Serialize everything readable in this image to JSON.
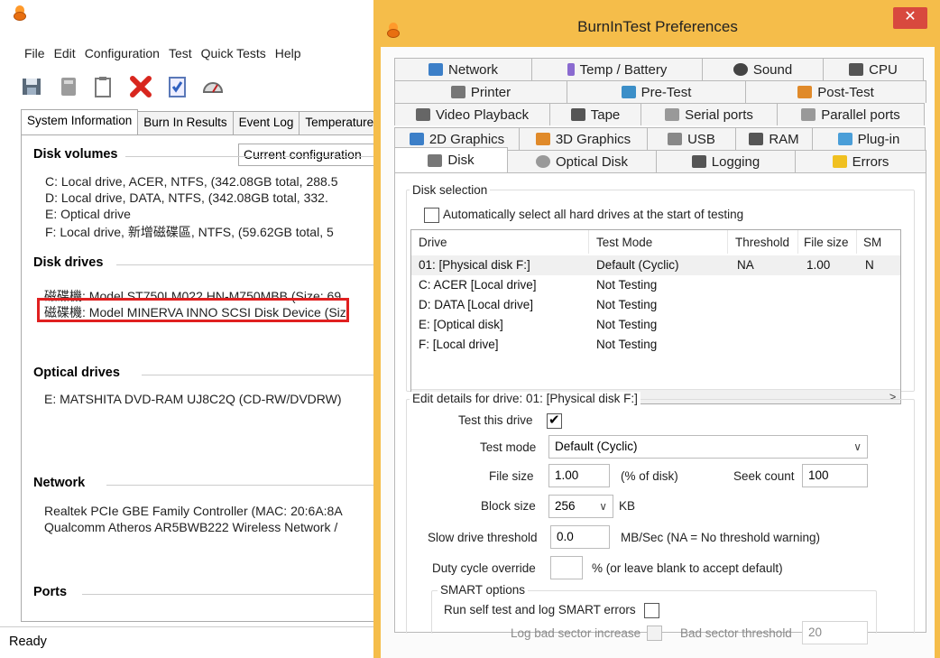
{
  "main_window": {
    "menu": [
      "File",
      "Edit",
      "Configuration",
      "Test",
      "Quick Tests",
      "Help"
    ],
    "config_box": "Current configuration",
    "tabs": [
      "System Information",
      "Burn In Results",
      "Event Log",
      "Temperature"
    ],
    "sections": {
      "disk_volumes": {
        "title": "Disk volumes",
        "lines": [
          "C:  Local drive, ACER, NTFS, (342.08GB total, 288.5",
          "D:  Local drive, DATA, NTFS, (342.08GB total, 332.",
          "E:  Optical drive",
          "F:  Local drive, 新增磁碟區, NTFS, (59.62GB total, 5"
        ]
      },
      "disk_drives": {
        "title": "Disk drives",
        "lines": [
          "磁碟機: Model ST750LM022 HN-M750MBB (Size: 69",
          "磁碟機: Model MINERVA INNO SCSI Disk Device (Siz"
        ]
      },
      "optical_drives": {
        "title": "Optical drives",
        "lines": [
          "E: MATSHITA DVD-RAM UJ8C2Q (CD-RW/DVDRW)"
        ]
      },
      "network": {
        "title": "Network",
        "lines": [
          "Realtek PCIe GBE Family Controller (MAC: 20:6A:8A",
          "Qualcomm Atheros AR5BWB222 Wireless Network /"
        ]
      },
      "ports": {
        "title": "Ports"
      }
    },
    "status": "Ready"
  },
  "dialog": {
    "title": "BurnInTest Preferences",
    "close": "✕",
    "tab_rows": [
      [
        {
          "label": "Network",
          "icon": "network-icon",
          "color": "#3c7fc8"
        },
        {
          "label": "Temp / Battery",
          "icon": "thermometer-icon",
          "color": "#8a6ad0"
        },
        {
          "label": "Sound",
          "icon": "speaker-icon",
          "color": "#444444"
        },
        {
          "label": "CPU",
          "icon": "cpu-icon",
          "color": "#555555"
        }
      ],
      [
        {
          "label": "Printer",
          "icon": "printer-icon",
          "color": "#777777"
        },
        {
          "label": "Pre-Test",
          "icon": "pretest-icon",
          "color": "#3c8fc8"
        },
        {
          "label": "Post-Test",
          "icon": "posttest-icon",
          "color": "#e08a2a"
        }
      ],
      [
        {
          "label": "Video Playback",
          "icon": "film-icon",
          "color": "#666666"
        },
        {
          "label": "Tape",
          "icon": "tape-icon",
          "color": "#555555"
        },
        {
          "label": "Serial ports",
          "icon": "serial-port-icon",
          "color": "#999999"
        },
        {
          "label": "Parallel ports",
          "icon": "parallel-port-icon",
          "color": "#999999"
        }
      ],
      [
        {
          "label": "2D Graphics",
          "icon": "monitor-icon",
          "color": "#3c7fc8"
        },
        {
          "label": "3D Graphics",
          "icon": "cubes-icon",
          "color": "#e08a2a"
        },
        {
          "label": "USB",
          "icon": "usb-icon",
          "color": "#888888"
        },
        {
          "label": "RAM",
          "icon": "ram-icon",
          "color": "#555555"
        },
        {
          "label": "Plug-in",
          "icon": "plugin-icon",
          "color": "#4a9ed8"
        }
      ],
      [
        {
          "label": "Disk",
          "icon": "disk-icon",
          "color": "#777777"
        },
        {
          "label": "Optical Disk",
          "icon": "optical-disc-icon",
          "color": "#999999"
        },
        {
          "label": "Logging",
          "icon": "log-icon",
          "color": "#555555"
        },
        {
          "label": "Errors",
          "icon": "warning-icon",
          "color": "#f0c020"
        }
      ]
    ],
    "disk_selection": {
      "group_label": "Disk selection",
      "auto_select_label": "Automatically select all hard drives at the start of testing",
      "columns": [
        "Drive",
        "Test Mode",
        "Threshold",
        "File size",
        "SM"
      ],
      "rows": [
        [
          "01:  [Physical disk F:]",
          "Default (Cyclic)",
          "NA",
          "1.00",
          "N"
        ],
        [
          "C:  ACER [Local drive]",
          "Not Testing",
          "",
          "",
          ""
        ],
        [
          "D:  DATA [Local drive]",
          "Not Testing",
          "",
          "",
          ""
        ],
        [
          "E:  [Optical disk]",
          "Not Testing",
          "",
          "",
          ""
        ],
        [
          "F:  [Local drive]",
          "Not Testing",
          "",
          "",
          ""
        ]
      ],
      "scroll_left": "<",
      "scroll_right": ">"
    },
    "edit_details": {
      "group_label": "Edit details for drive: 01:  [Physical disk F:]",
      "test_this_drive": "Test this drive",
      "test_mode_label": "Test mode",
      "test_mode_value": "Default (Cyclic)",
      "file_size_label": "File size",
      "file_size_value": "1.00",
      "file_size_unit": "(% of disk)",
      "seek_count_label": "Seek count",
      "seek_count_value": "100",
      "block_size_label": "Block size",
      "block_size_value": "256",
      "block_size_unit": "KB",
      "slow_threshold_label": "Slow drive threshold",
      "slow_threshold_value": "0.0",
      "slow_threshold_unit": "MB/Sec  (NA = No threshold warning)",
      "duty_cycle_label": "Duty cycle override",
      "duty_cycle_value": "",
      "duty_cycle_note": "% (or leave blank to accept default)",
      "smart": {
        "group_label": "SMART options",
        "self_test_label": "Run self test and log SMART errors",
        "log_bad_sector_label": "Log bad sector increase",
        "bad_sector_threshold_label": "Bad sector threshold",
        "bad_sector_threshold_value": "20"
      }
    }
  },
  "colors": {
    "dialog_frame": "#f5bd4a",
    "close_button": "#d8493e",
    "highlight_box": "#e02020"
  }
}
